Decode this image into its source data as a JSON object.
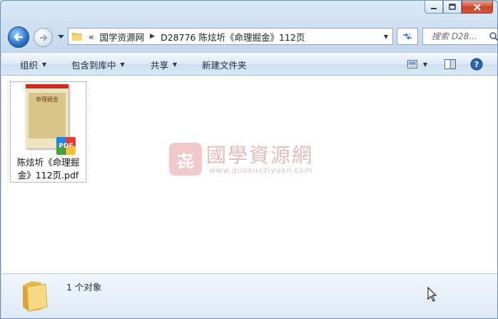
{
  "window": {
    "caption_buttons": [
      "minimize",
      "maximize",
      "close"
    ]
  },
  "nav": {
    "address_overflow": "«",
    "breadcrumbs": [
      {
        "label": "国学资源网"
      },
      {
        "label": "D28776 陈炫圻《命理掘金》112页"
      }
    ],
    "search_placeholder": "搜索 D28..."
  },
  "toolbar": {
    "organize": "组织",
    "include_in_library": "包含到库中",
    "share": "共享",
    "new_folder": "新建文件夹"
  },
  "content": {
    "files": [
      {
        "name": "陈炫圻《命理掘金》112页.pdf",
        "name_line1": "陈炫圻《命理掘",
        "name_line2": "金》112页.pdf",
        "thumb_title": "命理掘金",
        "type_badge": "PDF"
      }
    ],
    "watermark": {
      "logo_char": "㐂",
      "text": "國學資源網",
      "url": "www.guoxueziyuan.com"
    }
  },
  "details": {
    "count_text": "1 个对象"
  },
  "colors": {
    "accent": "#2a72c6",
    "close_button": "#c9452c",
    "pdf_badge": [
      "#e53935",
      "#fbc02d",
      "#43a047",
      "#1e88e5"
    ]
  }
}
